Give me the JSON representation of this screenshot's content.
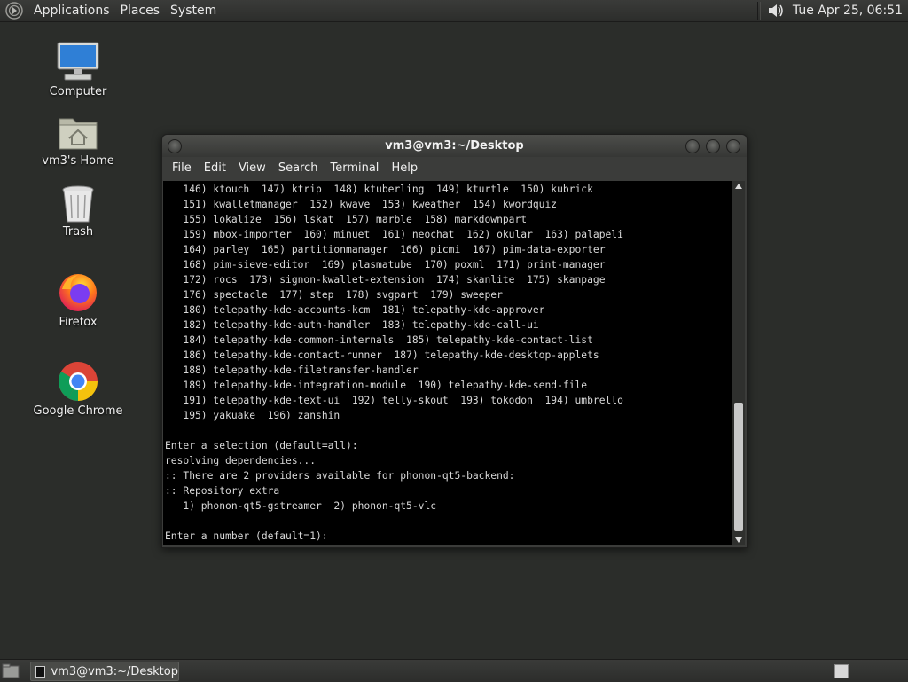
{
  "top_panel": {
    "menus": [
      "Applications",
      "Places",
      "System"
    ],
    "clock": "Tue Apr 25, 06:51",
    "icons": [
      "distro-logo-icon",
      "volume-icon"
    ]
  },
  "desktop_icons": [
    {
      "label": "Computer",
      "icon": "computer-icon"
    },
    {
      "label": "vm3's Home",
      "icon": "home-folder-icon"
    },
    {
      "label": "Trash",
      "icon": "trash-icon"
    },
    {
      "label": "Firefox",
      "icon": "firefox-icon"
    },
    {
      "label": "Google Chrome",
      "icon": "chrome-icon"
    }
  ],
  "terminal": {
    "title": "vm3@vm3:~/Desktop",
    "menu": [
      "File",
      "Edit",
      "View",
      "Search",
      "Terminal",
      "Help"
    ],
    "lines": [
      "   146) ktouch  147) ktrip  148) ktuberling  149) kturtle  150) kubrick",
      "   151) kwalletmanager  152) kwave  153) kweather  154) kwordquiz",
      "   155) lokalize  156) lskat  157) marble  158) markdownpart",
      "   159) mbox-importer  160) minuet  161) neochat  162) okular  163) palapeli",
      "   164) parley  165) partitionmanager  166) picmi  167) pim-data-exporter",
      "   168) pim-sieve-editor  169) plasmatube  170) poxml  171) print-manager",
      "   172) rocs  173) signon-kwallet-extension  174) skanlite  175) skanpage",
      "   176) spectacle  177) step  178) svgpart  179) sweeper",
      "   180) telepathy-kde-accounts-kcm  181) telepathy-kde-approver",
      "   182) telepathy-kde-auth-handler  183) telepathy-kde-call-ui",
      "   184) telepathy-kde-common-internals  185) telepathy-kde-contact-list",
      "   186) telepathy-kde-contact-runner  187) telepathy-kde-desktop-applets",
      "   188) telepathy-kde-filetransfer-handler",
      "   189) telepathy-kde-integration-module  190) telepathy-kde-send-file",
      "   191) telepathy-kde-text-ui  192) telly-skout  193) tokodon  194) umbrello",
      "   195) yakuake  196) zanshin",
      "",
      "Enter a selection (default=all):",
      "resolving dependencies...",
      ":: There are 2 providers available for phonon-qt5-backend:",
      ":: Repository extra",
      "   1) phonon-qt5-gstreamer  2) phonon-qt5-vlc",
      "",
      "Enter a number (default=1):"
    ]
  },
  "bottom_panel": {
    "task_label": "vm3@vm3:~/Desktop"
  }
}
